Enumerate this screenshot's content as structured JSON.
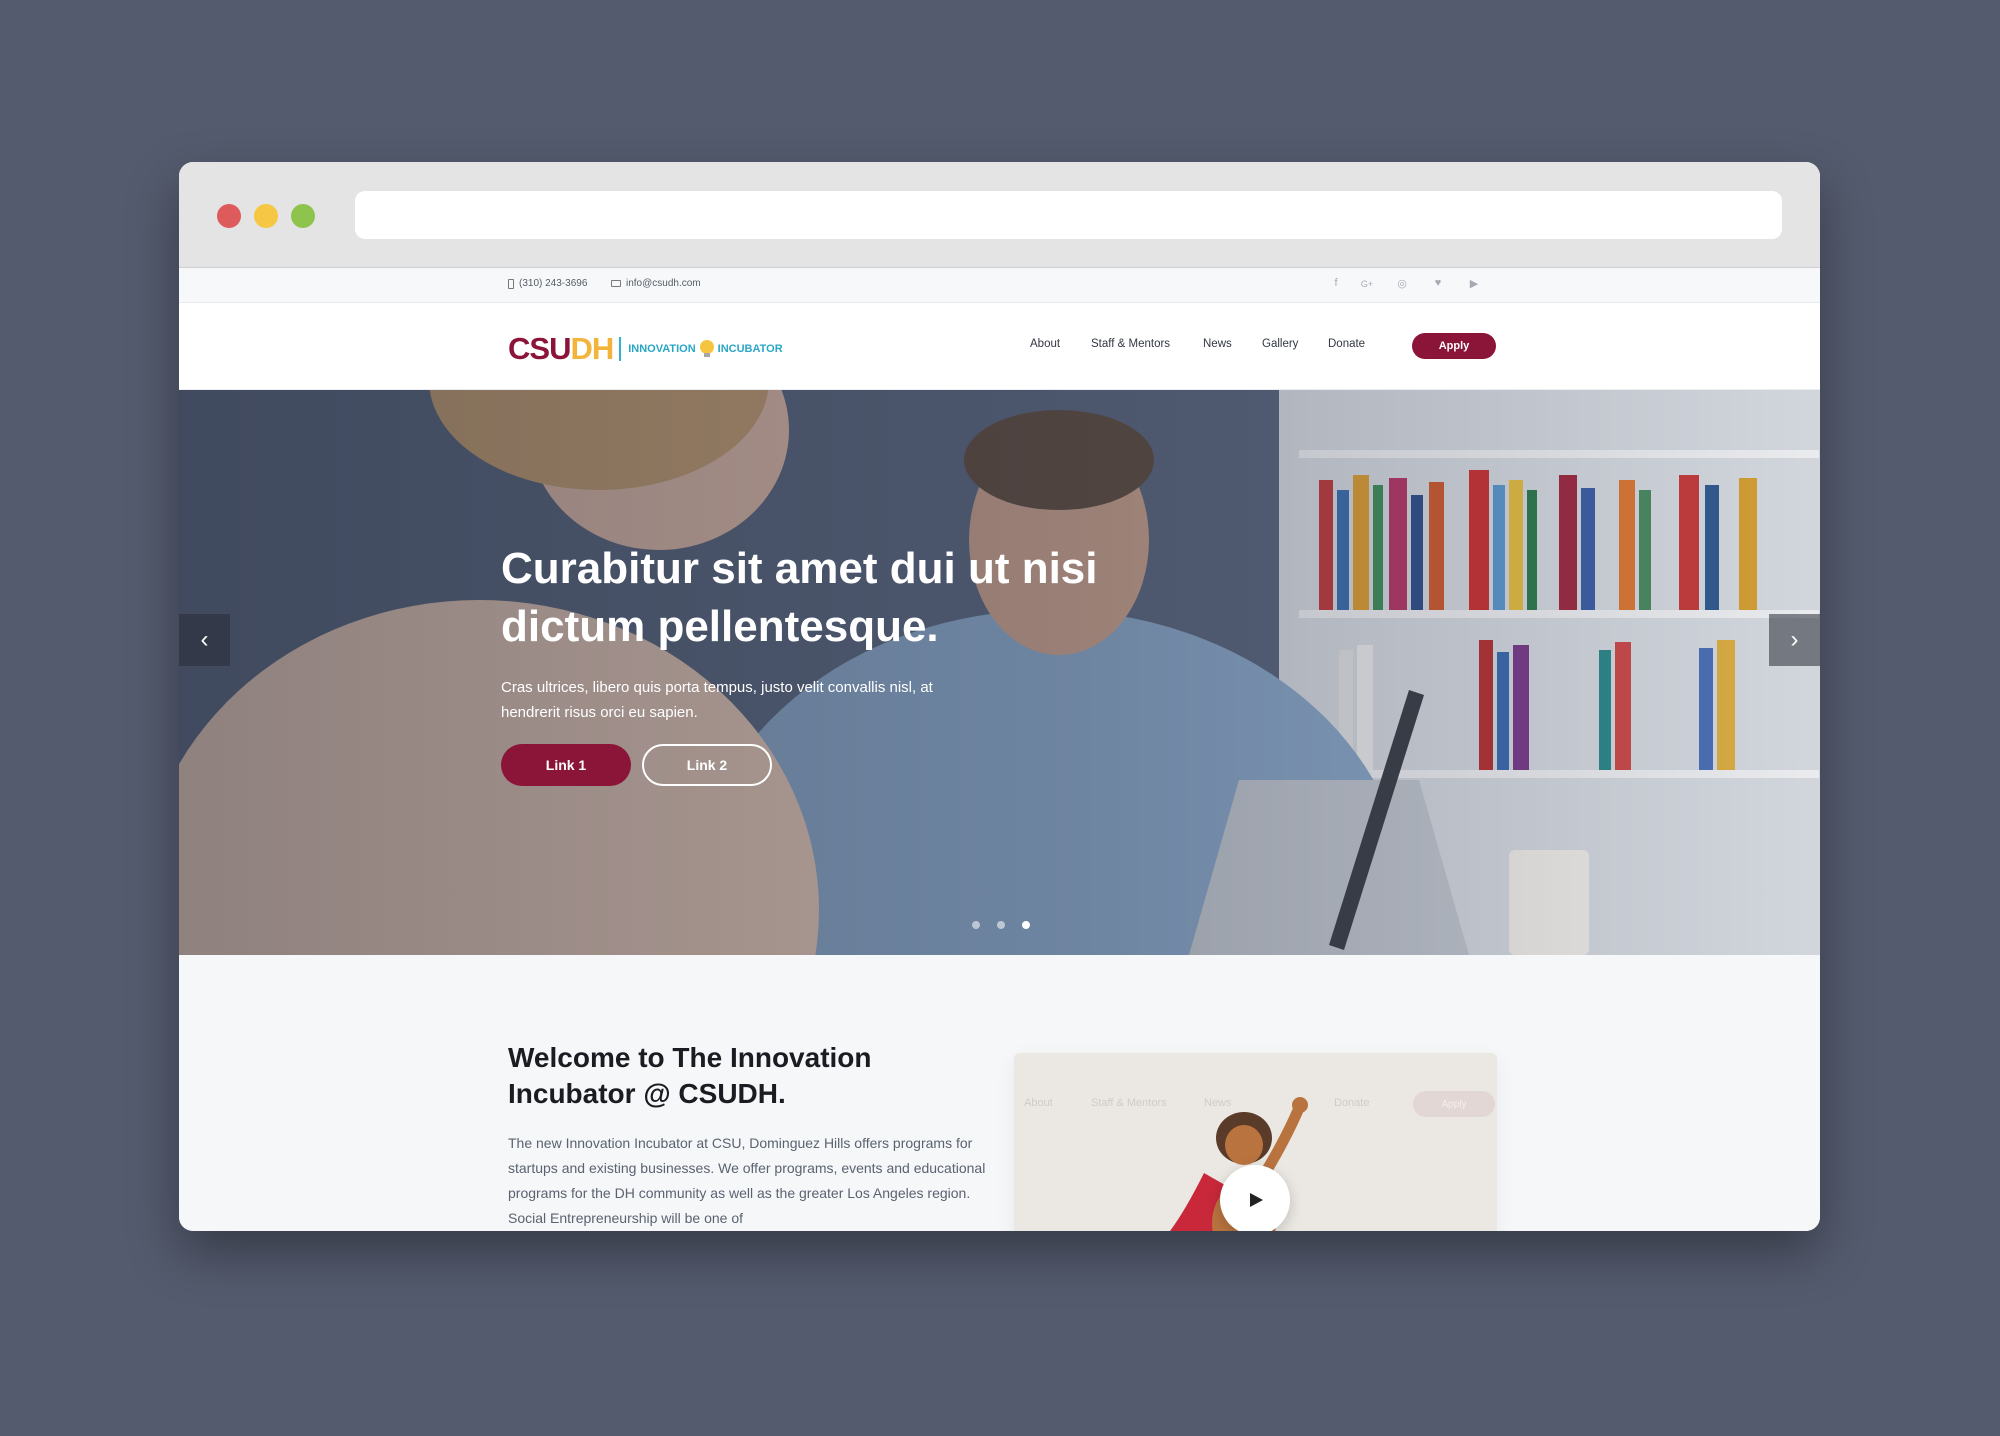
{
  "topbar": {
    "phone": "(310) 243-3696",
    "email": "info@csudh.com",
    "social_icons": [
      "facebook-icon",
      "google-plus-icon",
      "instagram-icon",
      "twitter-icon",
      "youtube-icon"
    ]
  },
  "header": {
    "logo": {
      "csu": "CSU",
      "dh": "DH",
      "innovation": "INNOVATION",
      "incubator": "INCUBATOR"
    },
    "nav": [
      "About",
      "Staff & Mentors",
      "News",
      "Gallery",
      "Donate"
    ],
    "apply": "Apply"
  },
  "hero": {
    "title": "Curabitur sit amet dui ut nisi dictum pellentesque.",
    "subtitle": "Cras ultrices, libero quis porta tempus, justo velit convallis nisl, at hendrerit risus orci eu sapien.",
    "link1": "Link 1",
    "link2": "Link 2",
    "slides_total": 3,
    "active_slide": 3
  },
  "welcome": {
    "title": "Welcome to The Innovation Incubator @ CSUDH.",
    "body": "The new Innovation Incubator at CSU, Dominguez Hills offers programs for startups and existing businesses. We offer programs, events and educational programs for the DH community as well as the greater Los Angeles region. Social Entrepreneurship will be one of",
    "video_thumbnail_nav": [
      "About",
      "Staff & Mentors",
      "News",
      "Donate"
    ],
    "video_thumbnail_apply": "Apply"
  },
  "colors": {
    "brand_maroon": "#8b1538",
    "brand_gold": "#f2b43a",
    "accent_teal": "#2aa6c6"
  }
}
